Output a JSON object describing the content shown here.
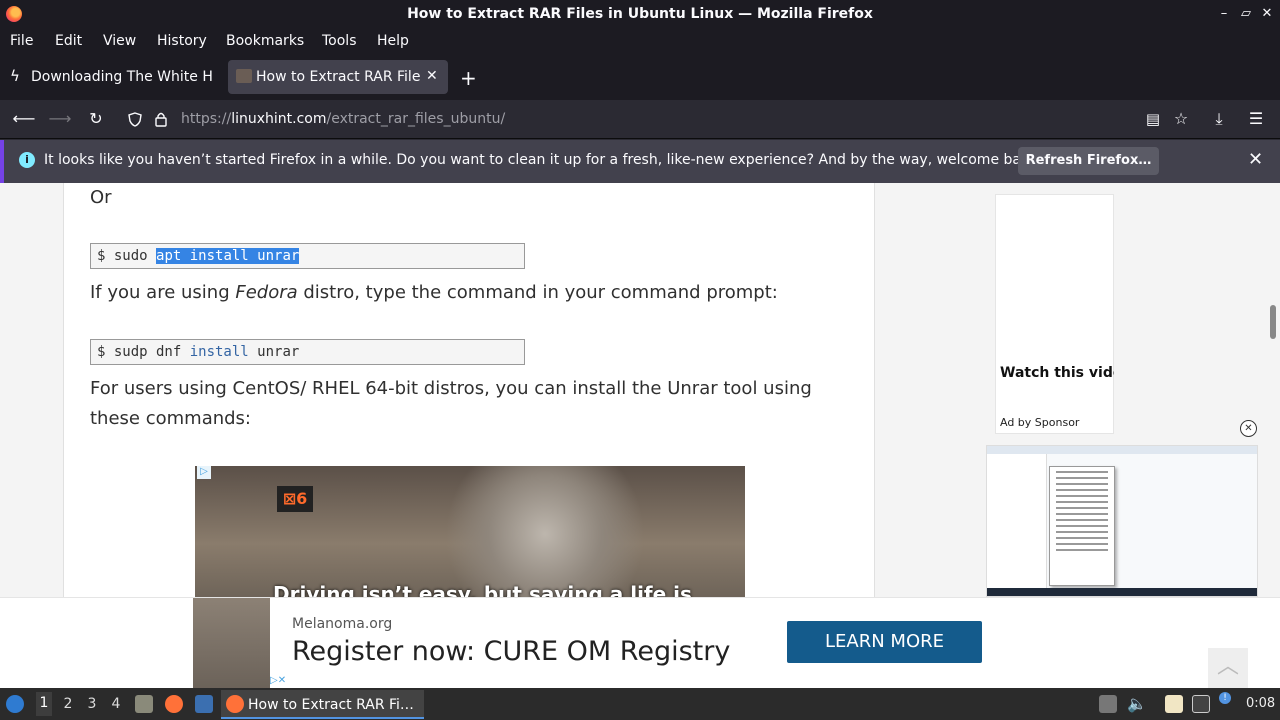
{
  "window": {
    "title": "How to Extract RAR Files in Ubuntu Linux — Mozilla Firefox",
    "controls": [
      "–",
      "▱",
      "✕"
    ]
  },
  "menu": [
    "File",
    "Edit",
    "View",
    "History",
    "Bookmarks",
    "Tools",
    "Help"
  ],
  "tabs": [
    {
      "label": "Downloading The White H",
      "active": false
    },
    {
      "label": "How to Extract RAR Files",
      "active": true
    }
  ],
  "new_tab_label": "+",
  "url": {
    "prefix": "https://",
    "domain": "linuxhint.com",
    "path": "/extract_rar_files_ubuntu/"
  },
  "notification": {
    "message": "It looks like you haven’t started Firefox in a while. Do you want to clean it up for a fresh, like-new experience? And by the way, welcome back!",
    "button": "Refresh Firefox…"
  },
  "article": {
    "or": "Or",
    "cmd1": {
      "prompt": "$ sudo ",
      "selected": "apt install unrar"
    },
    "para_fedora_pre": "If you are using ",
    "para_fedora_em": "Fedora",
    "para_fedora_post": " distro, type the command in your command prompt:",
    "cmd2": {
      "prompt": "$ sudp dnf ",
      "kw": "install",
      "rest": " unrar"
    },
    "para_centos": "For users using CentOS/ RHEL 64-bit distros, you can install the Unrar tool using these commands:",
    "ad_image_sign": "⊠6",
    "ad_image_caption": "Driving isn’t easy, but saving a life is"
  },
  "side_ad": {
    "headline": "Watch this video information",
    "sponsor": "Ad by Sponsor"
  },
  "bottom_ad": {
    "org": "Melanoma.org",
    "headline": "Register now: CURE OM Registry",
    "cta": "LEARN MORE"
  },
  "taskbar": {
    "workspaces": [
      "1",
      "2",
      "3",
      "4"
    ],
    "active_task": "How to Extract RAR Fi…",
    "clock": "0:08"
  }
}
